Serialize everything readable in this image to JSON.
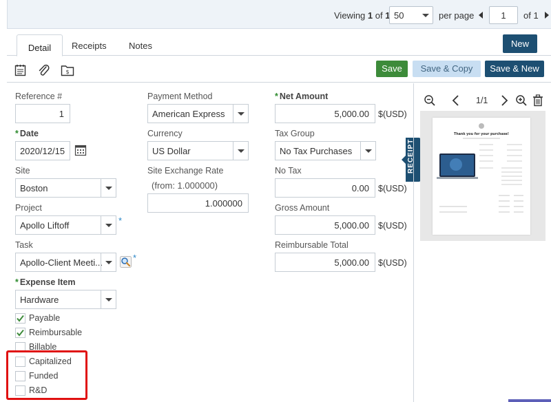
{
  "pager": {
    "viewing_prefix": "Viewing ",
    "viewing_current": "1",
    "viewing_of": " of ",
    "viewing_total": "1",
    "per_page_value": "50",
    "per_page_label": "per page",
    "page_value": "1",
    "of_pages": "of 1"
  },
  "tabs": {
    "detail": "Detail",
    "receipts": "Receipts",
    "notes": "Notes"
  },
  "buttons": {
    "new": "New",
    "save": "Save",
    "save_copy": "Save & Copy",
    "save_new": "Save & New"
  },
  "form": {
    "reference": {
      "label": "Reference #",
      "value": "1"
    },
    "date": {
      "label": "Date",
      "value": "2020/12/15"
    },
    "site": {
      "label": "Site",
      "value": "Boston"
    },
    "project": {
      "label": "Project",
      "value": "Apollo Liftoff"
    },
    "task": {
      "label": "Task",
      "value": "Apollo-Client Meeti..."
    },
    "expense_item": {
      "label": "Expense Item",
      "value": "Hardware"
    },
    "payment_method": {
      "label": "Payment Method",
      "value": "American Express"
    },
    "currency": {
      "label": "Currency",
      "value": "US Dollar"
    },
    "site_exchange_rate": {
      "label": "Site Exchange Rate",
      "note": "(from: 1.000000)",
      "value": "1.000000"
    },
    "net_amount": {
      "label": "Net Amount",
      "value": "5,000.00",
      "currency": "$(USD)"
    },
    "tax_group": {
      "label": "Tax Group",
      "value": "No Tax Purchases"
    },
    "no_tax": {
      "label": "No Tax",
      "value": "0.00",
      "currency": "$(USD)"
    },
    "gross_amount": {
      "label": "Gross Amount",
      "value": "5,000.00",
      "currency": "$(USD)"
    },
    "reimbursable_total": {
      "label": "Reimbursable Total",
      "value": "5,000.00",
      "currency": "$(USD)"
    },
    "required_star": "*"
  },
  "checkboxes": [
    {
      "label": "Payable",
      "checked": true
    },
    {
      "label": "Reimbursable",
      "checked": true
    },
    {
      "label": "Billable",
      "checked": false
    },
    {
      "label": "Capitalized",
      "checked": false
    },
    {
      "label": "Funded",
      "checked": false
    },
    {
      "label": "R&D",
      "checked": false
    }
  ],
  "receipt": {
    "page_indicator": "1/1",
    "tag_label": "RECEIPT",
    "receipt_heading": "Thank you for your purchase!"
  },
  "colors": {
    "primary": "#1d4f72",
    "save_green": "#3d8b3a",
    "required_green": "#2e8b2e",
    "highlight_red": "#e01010"
  }
}
